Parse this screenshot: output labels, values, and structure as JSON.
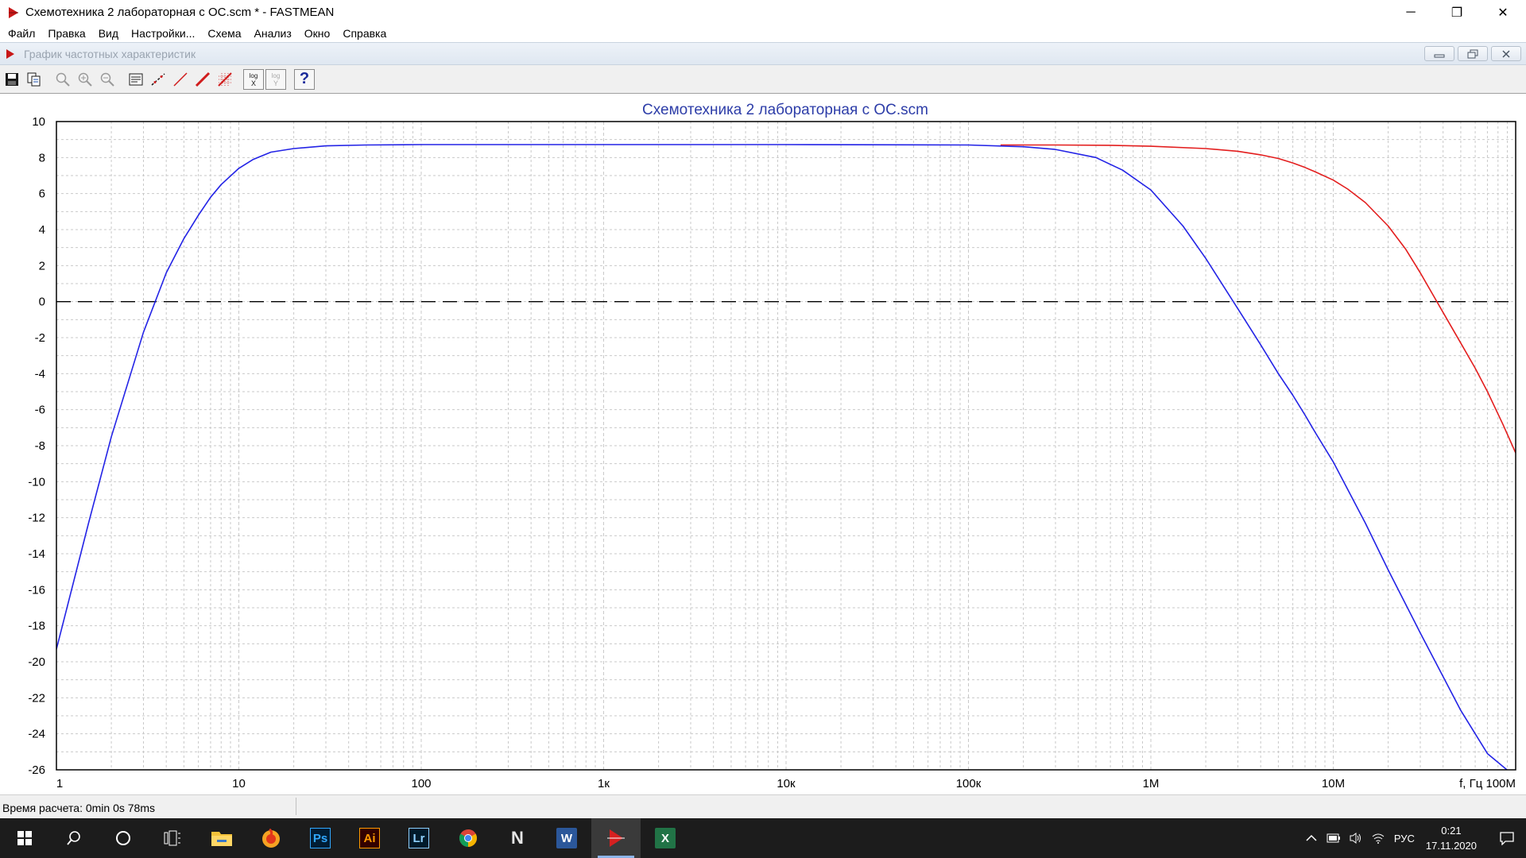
{
  "window": {
    "title": "Схемотехника 2 лабораторная с ОС.scm * - FASTMEAN",
    "minimize_glyph": "─",
    "restore_glyph": "❐",
    "close_glyph": "✕"
  },
  "menu": [
    {
      "label": "Файл"
    },
    {
      "label": "Правка"
    },
    {
      "label": "Вид"
    },
    {
      "label": "Настройки..."
    },
    {
      "label": "Схема"
    },
    {
      "label": "Анализ"
    },
    {
      "label": "Окно"
    },
    {
      "label": "Справка"
    }
  ],
  "child_window": {
    "title": "График частотных характеристик"
  },
  "toolbar": {
    "log_label": "log",
    "log_x_axis": "X",
    "log_y_axis": "Y",
    "help_glyph": "?"
  },
  "chart_data": {
    "type": "line",
    "title": "Схемотехника 2 лабораторная с ОС.scm",
    "xscale": "log",
    "xlim": [
      1,
      100000000
    ],
    "ylim": [
      -26,
      10
    ],
    "x_ticks": [
      1,
      10,
      100,
      1000,
      10000,
      100000,
      1000000,
      10000000
    ],
    "x_tick_labels": [
      "1",
      "10",
      "100",
      "1к",
      "10к",
      "100к",
      "1М",
      "10М"
    ],
    "x_axis_end_label": "f, Гц 100М",
    "y_ticks": [
      10,
      8,
      6,
      4,
      2,
      0,
      -2,
      -4,
      -6,
      -8,
      -10,
      -12,
      -14,
      -16,
      -18,
      -20,
      -22,
      -24,
      -26
    ],
    "y_tick_labels": [
      "10",
      "8",
      "6",
      "4",
      "2",
      "0",
      "-2",
      "-4",
      "-6",
      "-8",
      "-10",
      "-12",
      "-14",
      "-16",
      "-18",
      "-20",
      "-22",
      "-24",
      "-26"
    ],
    "grid": true,
    "reference_line": {
      "y": 0,
      "style": "dashed",
      "color": "#000000"
    },
    "series": [
      {
        "color": "#e31e1e",
        "x": [
          150000,
          300000,
          600000,
          1000000,
          2000000,
          3000000,
          4000000,
          5000000,
          6000000,
          7000000,
          8000000,
          10000000,
          12000000,
          15000000,
          20000000,
          25000000,
          30000000,
          40000000,
          50000000,
          60000000,
          70000000,
          85000000,
          100000000
        ],
        "y": [
          8.7,
          8.7,
          8.68,
          8.63,
          8.5,
          8.35,
          8.15,
          7.95,
          7.7,
          7.45,
          7.2,
          6.75,
          6.25,
          5.5,
          4.2,
          2.9,
          1.6,
          -0.6,
          -2.3,
          -3.7,
          -5.0,
          -6.8,
          -8.4
        ]
      },
      {
        "color": "#2323e6",
        "x": [
          1,
          1.5,
          2,
          3,
          4,
          5,
          6,
          7,
          8,
          10,
          12,
          15,
          20,
          30,
          50,
          100,
          1000,
          10000,
          100000,
          200000,
          300000,
          500000,
          700000,
          1000000,
          1500000,
          2000000,
          3000000,
          4000000,
          5000000,
          6000000,
          7000000,
          8000000,
          10000000,
          15000000,
          20000000,
          30000000,
          50000000,
          70000000,
          100000000
        ],
        "y": [
          -19.3,
          -12.3,
          -7.5,
          -1.7,
          1.6,
          3.5,
          4.8,
          5.8,
          6.5,
          7.4,
          7.9,
          8.3,
          8.5,
          8.65,
          8.7,
          8.72,
          8.72,
          8.72,
          8.7,
          8.6,
          8.45,
          8.0,
          7.3,
          6.2,
          4.2,
          2.4,
          -0.4,
          -2.4,
          -4.0,
          -5.2,
          -6.3,
          -7.3,
          -8.9,
          -12.3,
          -14.9,
          -18.4,
          -22.7,
          -25.1,
          -26.4
        ]
      }
    ]
  },
  "status": {
    "text": "Время расчета: 0min 0s 78ms"
  },
  "taskbar": {
    "apps": [
      {
        "name": "file-explorer",
        "glyph": "",
        "color": "#f4c23a"
      },
      {
        "name": "yandex-browser",
        "glyph": "",
        "color": "#f86b1f"
      },
      {
        "name": "photoshop",
        "glyph": "Ps",
        "color": "#31a8ff"
      },
      {
        "name": "illustrator",
        "glyph": "Ai",
        "color": "#ff9a00"
      },
      {
        "name": "lightroom",
        "glyph": "Lr",
        "color": "#8fd0ff"
      },
      {
        "name": "chrome",
        "glyph": "",
        "color": "#4caf50"
      },
      {
        "name": "n-app",
        "glyph": "N",
        "color": "#e6e6e6"
      },
      {
        "name": "word",
        "glyph": "W",
        "color": "#2b579a"
      },
      {
        "name": "fastmean",
        "glyph": "",
        "color": "#d62020"
      },
      {
        "name": "excel",
        "glyph": "X",
        "color": "#217346"
      }
    ],
    "language": "РУС",
    "time": "0:21",
    "date": "17.11.2020"
  }
}
